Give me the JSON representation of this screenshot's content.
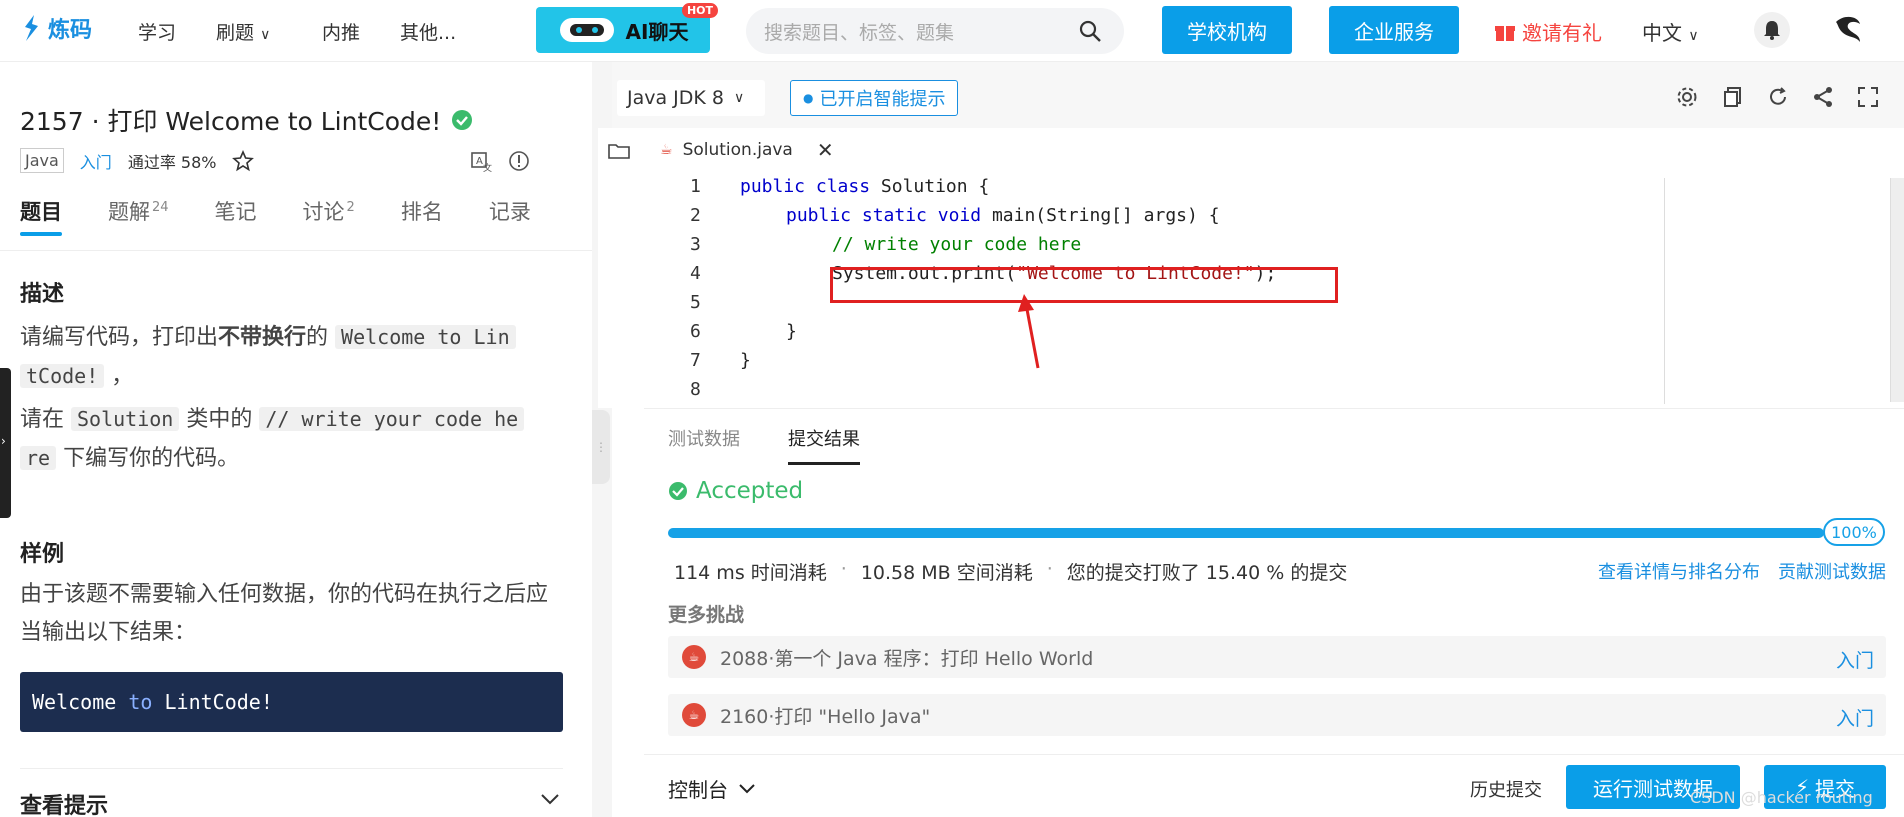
{
  "topbar": {
    "logo_text": "炼码",
    "nav": [
      "学习",
      "刷题",
      "内推",
      "其他..."
    ],
    "ai_chat": "AI聊天",
    "hot_badge": "HOT",
    "search_placeholder": "搜索题目、标签、题集",
    "school_btn": "学校机构",
    "enterprise_btn": "企业服务",
    "invite": "邀请有礼",
    "lang": "中文",
    "accent": "#0a9ee8"
  },
  "problem": {
    "title": "2157 · 打印 Welcome to LintCode!",
    "lang_tag": "Java",
    "level": "入门",
    "pass_rate": "通过率 58%",
    "tabs": [
      {
        "label": "题目",
        "count": ""
      },
      {
        "label": "题解",
        "count": "24"
      },
      {
        "label": "笔记",
        "count": ""
      },
      {
        "label": "讨论",
        "count": "2"
      },
      {
        "label": "排名",
        "count": ""
      },
      {
        "label": "记录",
        "count": ""
      }
    ],
    "desc_heading": "描述",
    "desc_p1_a": "请编写代码，打印出",
    "desc_p1_b": "不带换行",
    "desc_p1_c": "的",
    "desc_p1_code_a": "Welcome to Lin",
    "desc_p1_code_b": "tCode!",
    "desc_p1_d": "，",
    "desc_p2_a": "请在",
    "desc_p2_code1": "Solution",
    "desc_p2_b": "类中的",
    "desc_p2_code2_a": "// write your code he",
    "desc_p2_code2_b": "re",
    "desc_p2_c": "下编写你的代码。",
    "sample_heading": "样例",
    "sample_text": "由于该题不需要输入任何数据，你的代码在执行之后应当输出以下结果：",
    "sample_w1": "Welcome",
    "sample_w2": "to",
    "sample_w3": "LintCode!",
    "hint_heading": "查看提示"
  },
  "editor": {
    "jdk": "Java JDK 8",
    "ai_hint": "已开启智能提示",
    "file_name": "Solution.java",
    "lines": [
      "1",
      "2",
      "3",
      "4",
      "5",
      "6",
      "7",
      "8"
    ],
    "code": {
      "l1_kw1": "public",
      "l1_kw2": "class",
      "l1_rest": "Solution {",
      "l2_kw1": "public",
      "l2_kw2": "static",
      "l2_kw3": "void",
      "l2_rest": "main(String[] args) {",
      "l3": "// write your code here",
      "l4_a": "System.out.print(",
      "l4_str": "\"Welcome to LintCode!\"",
      "l4_b": ");",
      "l6": "}",
      "l7": "}"
    }
  },
  "result": {
    "tabs": [
      "测试数据",
      "提交结果"
    ],
    "status": "Accepted",
    "progress": 100,
    "progress_label": "100%",
    "time": "114 ms 时间消耗",
    "memory": "10.58 MB 空间消耗",
    "beat": "您的提交打败了 15.40 % 的提交",
    "link_details": "查看详情与排名分布",
    "link_testdata": "贡献测试数据",
    "more_heading": "更多挑战",
    "challenges": [
      {
        "title": "2088·第一个 Java 程序：打印 Hello World",
        "level": "入门"
      },
      {
        "title": "2160·打印 \"Hello Java\"",
        "level": "入门"
      }
    ]
  },
  "bottom": {
    "console": "控制台",
    "history": "历史提交",
    "run": "运行测试数据",
    "submit": "提交",
    "watermark": "CSDN @hacker routing"
  }
}
